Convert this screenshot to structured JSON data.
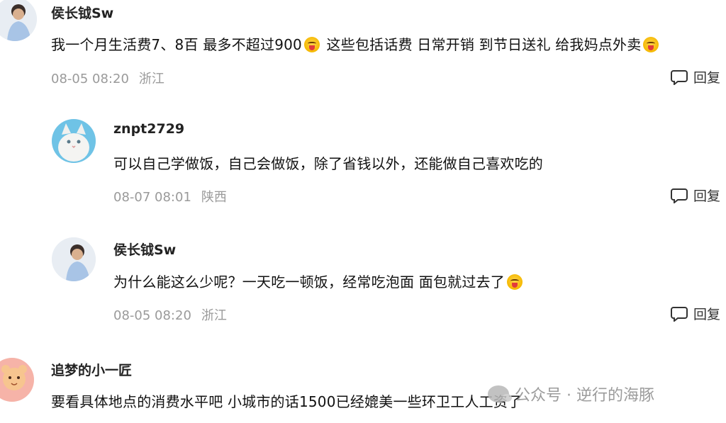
{
  "comments": [
    {
      "username": "侯长钺Sw",
      "text": "我一个月生活费7、8百 最多不超过900",
      "text_2": " 这些包括话费 日常开销 到节日送礼 给我妈点外卖",
      "date": "08-05 08:20",
      "location": "浙江",
      "reply_label": "回复"
    },
    {
      "username": "znpt2729",
      "text": "可以自己学做饭，自己会做饭，除了省钱以外，还能做自己喜欢吃的",
      "date": "08-07 08:01",
      "location": "陕西",
      "reply_label": "回复"
    },
    {
      "username": "侯长钺Sw",
      "text": "为什么能这么少呢？一天吃一顿饭，经常吃泡面 面包就过去了",
      "date": "08-05 08:20",
      "location": "浙江",
      "reply_label": "回复"
    },
    {
      "username": "追梦的小一匠",
      "text": "要看具体地点的消费水平吧 小城市的话1500已经媲美一些环卫工人工资了"
    }
  ],
  "watermark": "公众号 · 逆行的海豚",
  "emoji": "squinting-tongue-emoji",
  "colors": {
    "meta": "#9a9a9a",
    "text": "#111111"
  }
}
